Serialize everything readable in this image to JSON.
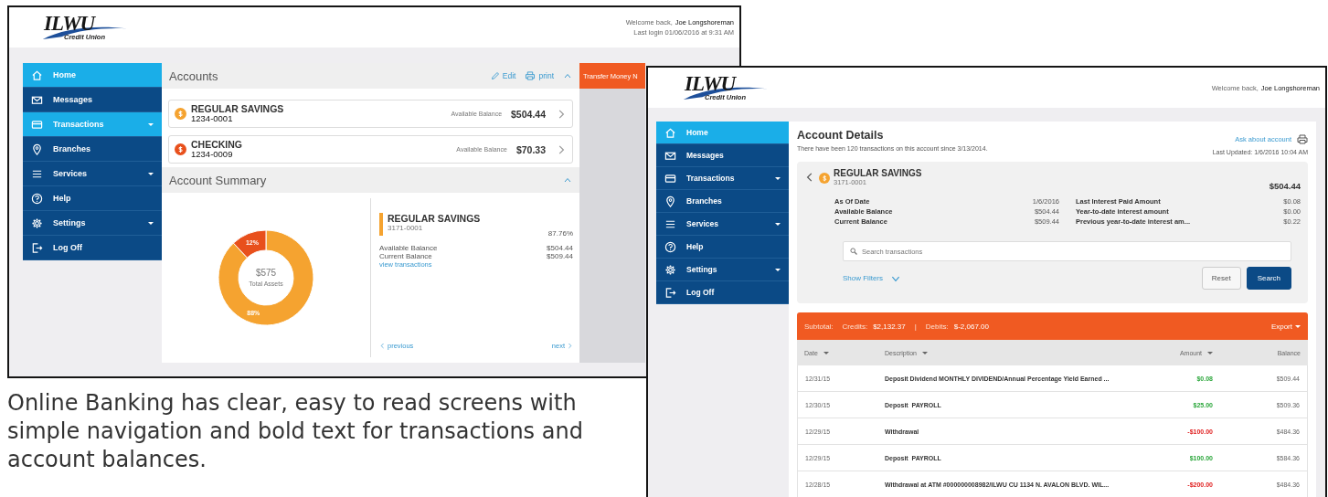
{
  "left_window": {
    "header": {
      "logo": {
        "name": "ILWU",
        "tagline": "Credit Union"
      },
      "welcome": "Welcome back,",
      "user": "Joe Longshoreman",
      "last_login": "Last login 01/06/2016 at 9:31 AM"
    },
    "sidebar": {
      "items": [
        {
          "label": "Home",
          "selected": true,
          "expandable": false
        },
        {
          "label": "Messages",
          "selected": false,
          "expandable": false
        },
        {
          "label": "Transactions",
          "selected": true,
          "expandable": true
        },
        {
          "label": "Branches",
          "selected": false,
          "expandable": false
        },
        {
          "label": "Services",
          "selected": false,
          "expandable": true
        },
        {
          "label": "Help",
          "selected": false,
          "expandable": false
        },
        {
          "label": "Settings",
          "selected": false,
          "expandable": true
        },
        {
          "label": "Log Off",
          "selected": false,
          "expandable": false
        }
      ]
    },
    "accounts": {
      "title": "Accounts",
      "actions": [
        {
          "label": "Edit"
        },
        {
          "label": "print"
        }
      ],
      "items": [
        {
          "name": "REGULAR SAVINGS",
          "number": "1234-0001",
          "balance_label": "Available Balance",
          "balance": "$504.44",
          "color": "#f5a330"
        },
        {
          "name": "CHECKING",
          "number": "1234-0009",
          "balance_label": "Available Balance",
          "balance": "$70.33",
          "color": "#e8501c"
        }
      ]
    },
    "summary": {
      "title": "Account Summary",
      "chart_data": {
        "type": "donut",
        "values": [
          88,
          12
        ],
        "value_labels": [
          "88%",
          "12%"
        ]
      },
      "total": "$575",
      "total_label": "Total Assets",
      "account": {
        "name": "REGULAR SAVINGS",
        "number": "3171-0001",
        "share": "87.76%",
        "color": "#f5a330",
        "rows": [
          {
            "label": "Available Balance",
            "value": "$504.44"
          },
          {
            "label": "Current Balance",
            "value": "$509.44"
          }
        ],
        "link": "view transactions"
      },
      "previous": "previous",
      "next": "next"
    },
    "side_panel": {
      "title": "Transfer Money N"
    }
  },
  "right_window": {
    "header": {
      "logo": {
        "name": "ILWU",
        "tagline": "Credit Union"
      },
      "welcome": "Welcome back,",
      "user": "Joe Longshoreman"
    },
    "sidebar": {
      "items": [
        {
          "label": "Home",
          "selected": true,
          "expandable": false
        },
        {
          "label": "Messages",
          "selected": false,
          "expandable": false
        },
        {
          "label": "Transactions",
          "selected": false,
          "expandable": true
        },
        {
          "label": "Branches",
          "selected": false,
          "expandable": false
        },
        {
          "label": "Services",
          "selected": false,
          "expandable": true
        },
        {
          "label": "Help",
          "selected": false,
          "expandable": false
        },
        {
          "label": "Settings",
          "selected": false,
          "expandable": true
        },
        {
          "label": "Log Off",
          "selected": false,
          "expandable": false
        }
      ]
    },
    "details": {
      "title": "Account Details",
      "subtitle": "There have been 120 transactions on this account since 3/13/2014.",
      "ask_link": "Ask about account",
      "last_updated": "Last Updated: 1/6/2016 10:04 AM",
      "account": {
        "name": "REGULAR SAVINGS",
        "number": "3171-0001",
        "balance": "$504.44",
        "color": "#f5a330",
        "fields": [
          {
            "label": "As Of Date",
            "value": "1/6/2016"
          },
          {
            "label": "Available Balance",
            "value": "$504.44"
          },
          {
            "label": "Current Balance",
            "value": "$509.44"
          },
          {
            "label": "Last Interest Paid Amount",
            "value": "$0.08"
          },
          {
            "label": "Year-to-date interest amount",
            "value": "$0.00"
          },
          {
            "label": "Previous year-to-date interest am...",
            "value": "$0.22"
          }
        ]
      },
      "search": {
        "placeholder": "Search transactions"
      },
      "show_filters": "Show Filters",
      "buttons": [
        {
          "label": "Reset",
          "kind": "secondary"
        },
        {
          "label": "Search",
          "kind": "primary"
        }
      ]
    },
    "transactions": {
      "subtotal_label": "Subtotal:",
      "credits_label": "Credits:",
      "credits": "$2,132.37",
      "separator": "|",
      "debits_label": "Debits:",
      "debits": "$-2,067.00",
      "export": "Export",
      "columns": [
        {
          "label": "Date",
          "sortable": true
        },
        {
          "label": "Description",
          "sortable": true
        },
        {
          "label": "Amount",
          "sortable": true
        },
        {
          "label": "Balance",
          "sortable": false
        }
      ],
      "rows": [
        {
          "date": "12/31/15",
          "description": "Deposit Dividend MONTHLY DIVIDEND/Annual Percentage Yield Earned ...",
          "amount": "$0.08",
          "kind": "credit",
          "balance": "$509.44"
        },
        {
          "date": "12/30/15",
          "description": "Deposit  PAYROLL",
          "amount": "$25.00",
          "kind": "credit",
          "balance": "$509.36"
        },
        {
          "date": "12/29/15",
          "description": "Withdrawal",
          "amount": "-$100.00",
          "kind": "debit",
          "balance": "$484.36"
        },
        {
          "date": "12/29/15",
          "description": "Deposit  PAYROLL",
          "amount": "$100.00",
          "kind": "credit",
          "balance": "$584.36"
        },
        {
          "date": "12/28/15",
          "description": "Withdrawal at ATM #000000008982/ILWU CU 1134 N. AVALON BLVD. WIL...",
          "amount": "-$200.00",
          "kind": "debit",
          "balance": "$484.36"
        }
      ]
    }
  },
  "caption": "Online Banking has clear, easy to read screens with simple navigation and bold text for transactions and account balances."
}
